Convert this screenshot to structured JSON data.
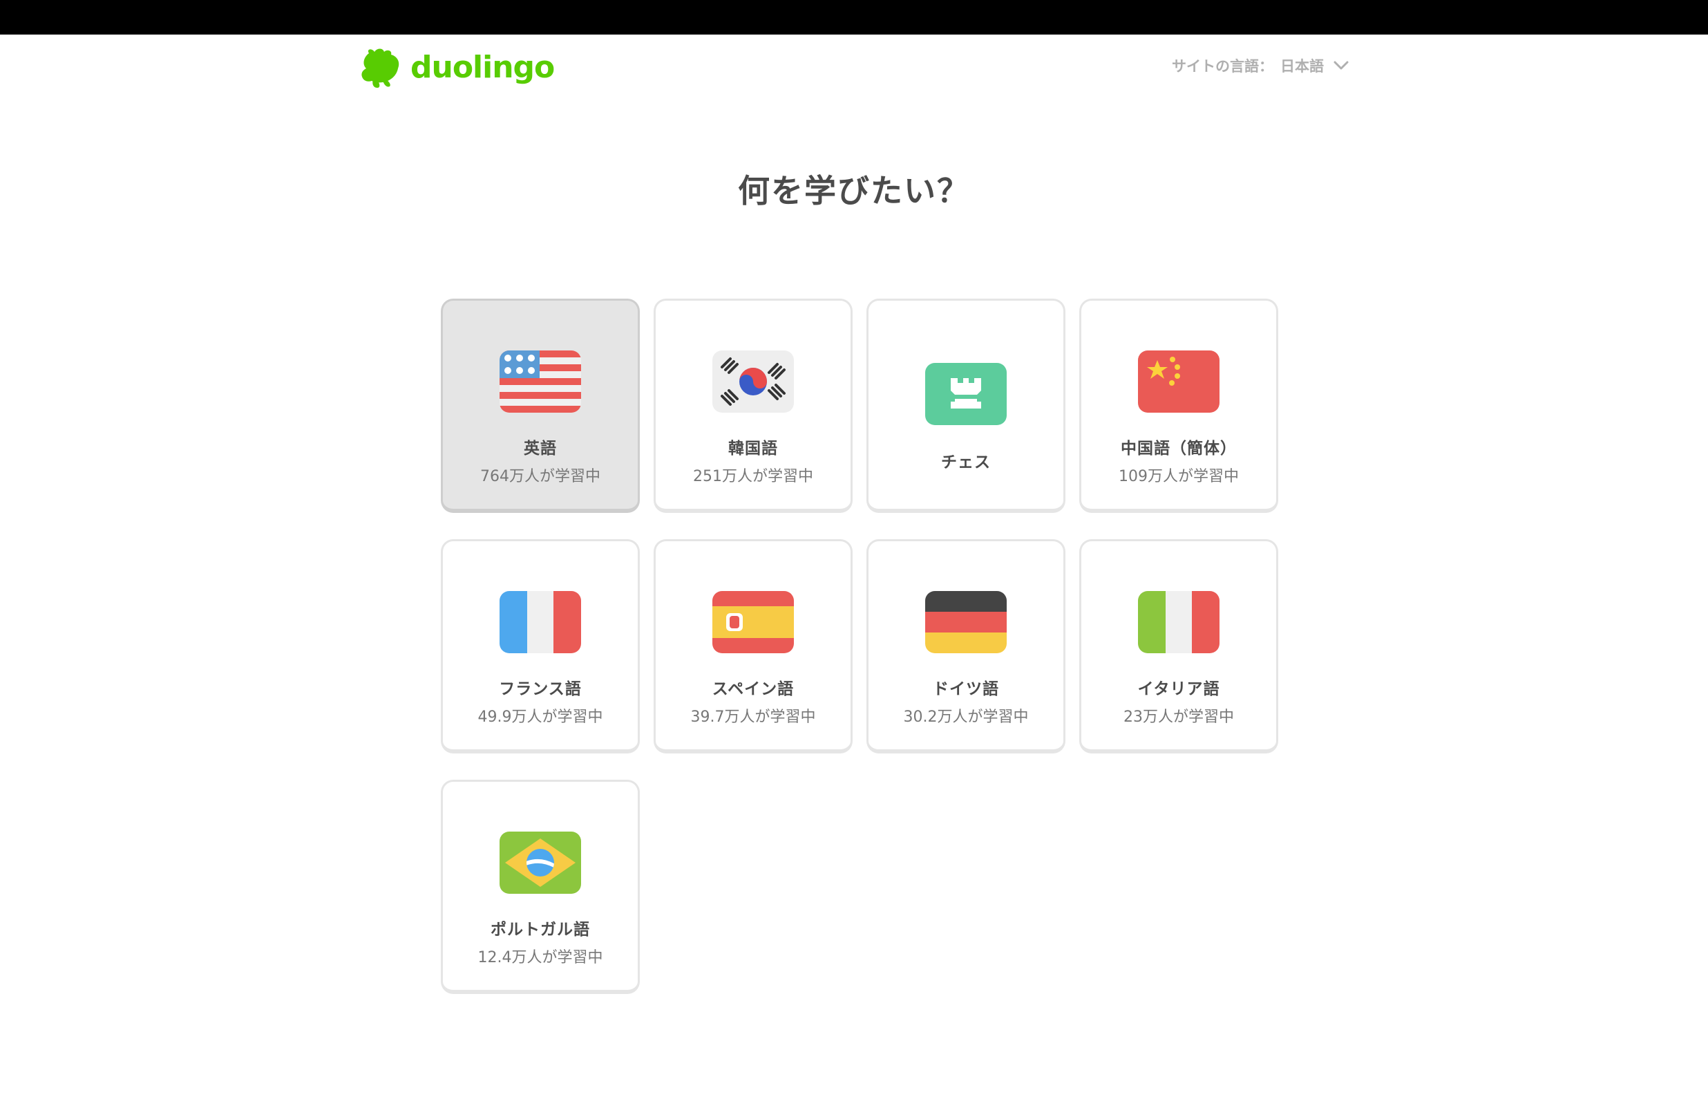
{
  "header": {
    "logo_text": "duolingo",
    "site_language_label": "サイトの言語：",
    "site_language_value": "日本語"
  },
  "page_title": "何を学びたい？",
  "colors": {
    "brand_green": "#58cc02",
    "text_dark": "#4b4b4b",
    "text_muted": "#777777",
    "border": "#e5e5e5",
    "selected_bg": "#e5e5e5"
  },
  "courses": [
    {
      "name": "英語",
      "learners": "764万人が学習中",
      "icon": "us-flag-icon",
      "selected": true
    },
    {
      "name": "韓国語",
      "learners": "251万人が学習中",
      "icon": "korea-flag-icon"
    },
    {
      "name": "チェス",
      "learners": "",
      "icon": "chess-rook-icon"
    },
    {
      "name": "中国語（簡体）",
      "learners": "109万人が学習中",
      "icon": "china-flag-icon"
    },
    {
      "name": "フランス語",
      "learners": "49.9万人が学習中",
      "icon": "france-flag-icon"
    },
    {
      "name": "スペイン語",
      "learners": "39.7万人が学習中",
      "icon": "spain-flag-icon"
    },
    {
      "name": "ドイツ語",
      "learners": "30.2万人が学習中",
      "icon": "germany-flag-icon"
    },
    {
      "name": "イタリア語",
      "learners": "23万人が学習中",
      "icon": "italy-flag-icon"
    },
    {
      "name": "ポルトガル語",
      "learners": "12.4万人が学習中",
      "icon": "brazil-flag-icon"
    }
  ]
}
